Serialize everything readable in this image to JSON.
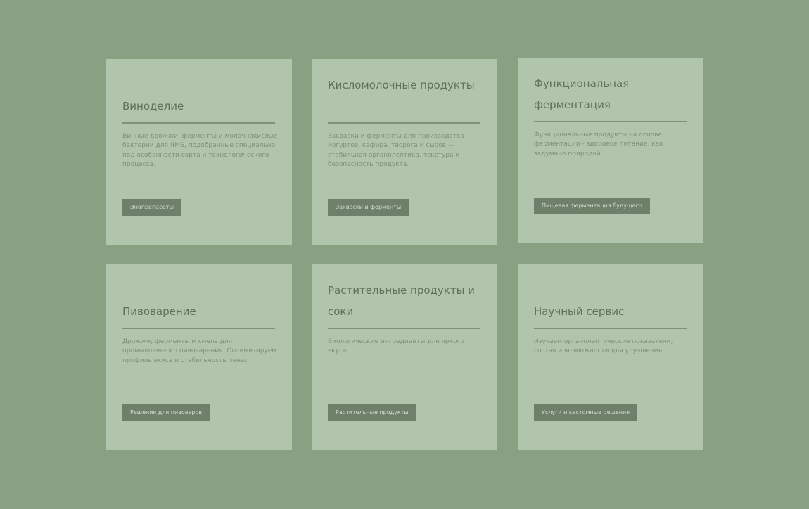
{
  "cards": [
    {
      "title": "Виноделие",
      "description": "Винные дрожжи, ферменты и молочнокислые бактерии для ЯМБ, подобранные специально под особенности сорта и технологического процесса.",
      "button_label": "Энопрепараты"
    },
    {
      "title": "Кисломолочные продукты",
      "description": "Закваски и ферменты для производства йогуртов, кефира, творога и сыров — стабильная органолептика, текстура и безопасность продукта.",
      "button_label": "Закваски и ферменты"
    },
    {
      "title": "Функциональная ферментация",
      "description": "Функциональные продукты на основе ферментации - здоровое питание, как задумано природой.",
      "button_label": "Пищевая ферментация будущего"
    },
    {
      "title": "Пивоварение",
      "description": "Дрожжи, ферменты и хмель для промышленного пивоварения. Оптимизируем профиль вкуса и стабильность пены.",
      "button_label": "Решения для пивоваров"
    },
    {
      "title": "Растительные продукты и соки",
      "description": "Биологические ингредиенты для яркого вкуса.",
      "button_label": "Растительные продукты"
    },
    {
      "title": "Научный сервис",
      "description": "Изучаем органолептические показатели, состав и возможности для улучшения.",
      "button_label": "Услуги и кастомные решения"
    }
  ]
}
